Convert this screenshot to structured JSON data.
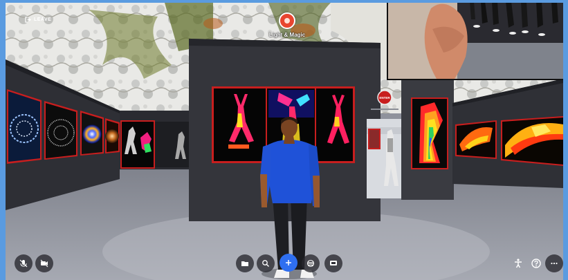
{
  "header": {
    "leave_label": "LEAVE",
    "room_name": "Light & Magic"
  },
  "sign_text": "ENTER",
  "controls": {
    "mic": {
      "icon": "mic-off-icon",
      "state": "muted"
    },
    "camera": {
      "icon": "camera-off-icon",
      "state": "off"
    },
    "folder": {
      "icon": "folder-icon"
    },
    "search": {
      "icon": "search-icon"
    },
    "add": {
      "icon": "plus-icon",
      "color": "#2f6ff0"
    },
    "layers": {
      "icon": "layers-icon"
    },
    "screen": {
      "icon": "screen-share-icon"
    },
    "accessibility": {
      "icon": "accessibility-icon"
    },
    "help": {
      "icon": "help-icon"
    },
    "more": {
      "icon": "more-icon"
    }
  },
  "colors": {
    "frame_border": "#c81e1e",
    "wall": "#34353b",
    "floor": "#8d9099",
    "page_border": "#5a9be0"
  }
}
